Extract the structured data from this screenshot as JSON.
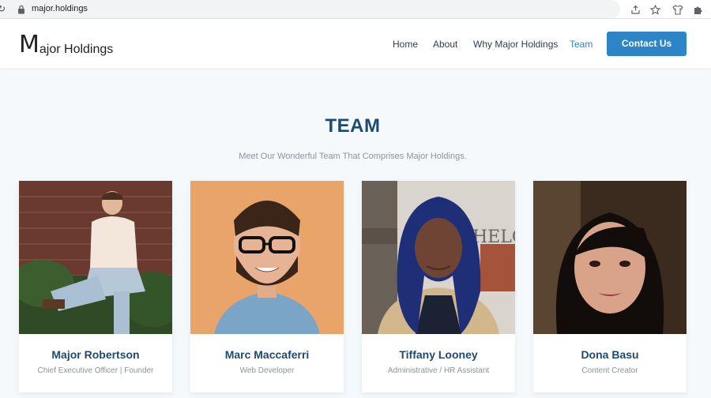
{
  "browser": {
    "url": "major.holdings",
    "icons": [
      "lock-icon",
      "share-icon",
      "star-icon",
      "extension-shirt-icon",
      "puzzle-icon"
    ]
  },
  "header": {
    "logo_initial": "M",
    "logo_rest": "ajor Holdings",
    "nav": [
      "Home",
      "About",
      "Why Major Holdings",
      "Team"
    ],
    "active_nav": "Team",
    "cta_label": "Contact Us",
    "accent_color": "#2d85c8",
    "title_color": "#1c4a73"
  },
  "team_section": {
    "title": "TEAM",
    "subtitle": "Meet Our Wonderful Team That Comprises Major Holdings.",
    "members": [
      {
        "name": "Major Robertson",
        "role": "Chief Executive Officer | Founder"
      },
      {
        "name": "Marc Maccaferri",
        "role": "Web Developer"
      },
      {
        "name": "Tiffany Looney",
        "role": "Administrative / HR Assistant"
      },
      {
        "name": "Dona Basu",
        "role": "Content Creator"
      }
    ]
  }
}
